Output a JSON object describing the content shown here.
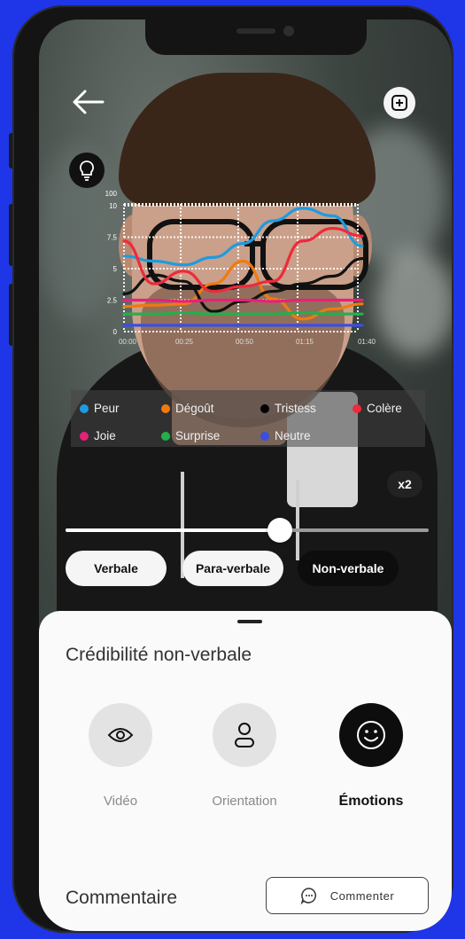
{
  "header": {
    "back_icon": "arrow-left-icon",
    "add_icon": "plus-square-icon",
    "tip_icon": "lightbulb-icon"
  },
  "chart_data": {
    "type": "line",
    "x_ticks": [
      "00:00",
      "00:25",
      "00:50",
      "01:15",
      "01:40"
    ],
    "y_ticks": [
      "100",
      "10",
      "7.5",
      "5",
      "2.5",
      "0"
    ],
    "series": [
      {
        "name": "Peur",
        "color": "#1e9be0",
        "values": [
          6.0,
          5.6,
          5.3,
          5.9,
          7.0,
          8.8,
          9.8,
          9.2,
          6.8
        ]
      },
      {
        "name": "Dégoût",
        "color": "#f07a10",
        "values": [
          2.0,
          2.1,
          2.2,
          3.8,
          5.6,
          2.6,
          1.0,
          1.8,
          2.2
        ]
      },
      {
        "name": "Tristess",
        "color": "#111111",
        "values": [
          3.0,
          4.5,
          4.0,
          1.6,
          2.4,
          3.2,
          3.8,
          4.4,
          5.8
        ]
      },
      {
        "name": "Colère",
        "color": "#ee2a3c",
        "values": [
          7.2,
          3.8,
          4.8,
          3.2,
          3.6,
          4.0,
          7.2,
          8.2,
          7.6
        ]
      },
      {
        "name": "Joie",
        "color": "#e8207a",
        "values": [
          2.5,
          2.5,
          2.4,
          2.5,
          2.5,
          2.4,
          2.5,
          2.5,
          2.5
        ]
      },
      {
        "name": "Surprise",
        "color": "#22b04a",
        "values": [
          1.4,
          1.4,
          1.5,
          1.4,
          1.4,
          1.4,
          1.5,
          1.4,
          1.4
        ]
      },
      {
        "name": "Neutre",
        "color": "#3b4ee0",
        "values": [
          0.5,
          0.5,
          0.5,
          0.5,
          0.5,
          0.5,
          0.5,
          0.5,
          0.5
        ]
      }
    ]
  },
  "legend": [
    {
      "label": "Peur",
      "color": "#1e9be0"
    },
    {
      "label": "Dégoût",
      "color": "#f07a10"
    },
    {
      "label": "Tristess",
      "color": "#111111"
    },
    {
      "label": "Colère",
      "color": "#ee2a3c"
    },
    {
      "label": "Joie",
      "color": "#e8207a"
    },
    {
      "label": "Surprise",
      "color": "#22b04a"
    },
    {
      "label": "Neutre",
      "color": "#3b4ee0"
    }
  ],
  "speed": "x2",
  "slider": {
    "progress": 0.59
  },
  "tabs": [
    {
      "label": "Verbale",
      "active": false
    },
    {
      "label": "Para-verbale",
      "active": false
    },
    {
      "label": "Non-verbale",
      "active": true
    }
  ],
  "sheet": {
    "title": "Crédibilité non-verbale",
    "options": [
      {
        "label": "Vidéo",
        "icon": "eye-icon",
        "active": false
      },
      {
        "label": "Orientation",
        "icon": "person-icon",
        "active": false
      },
      {
        "label": "Émotions",
        "icon": "smiley-icon",
        "active": true
      }
    ],
    "comment_title": "Commentaire",
    "comment_button": "Commenter",
    "comment_icon": "chat-bubble-icon"
  }
}
